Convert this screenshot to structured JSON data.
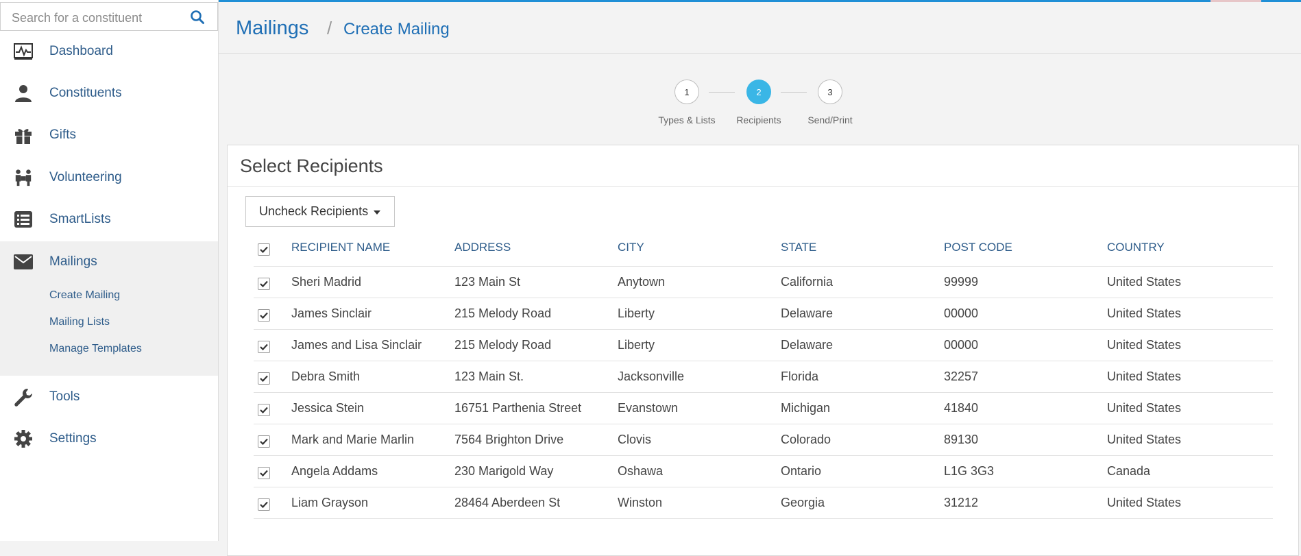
{
  "sidebar": {
    "search_placeholder": "Search for a constituent",
    "items": [
      {
        "label": "Dashboard",
        "icon": "dashboard-icon"
      },
      {
        "label": "Constituents",
        "icon": "person-icon"
      },
      {
        "label": "Gifts",
        "icon": "gift-icon"
      },
      {
        "label": "Volunteering",
        "icon": "volunteers-icon"
      },
      {
        "label": "SmartLists",
        "icon": "list-icon"
      },
      {
        "label": "Mailings",
        "icon": "envelope-icon"
      },
      {
        "label": "Tools",
        "icon": "wrench-icon"
      },
      {
        "label": "Settings",
        "icon": "gear-icon"
      }
    ],
    "mailings_sub": [
      "Create Mailing",
      "Mailing Lists",
      "Manage Templates"
    ]
  },
  "header": {
    "breadcrumb_root": "Mailings",
    "separator": "/",
    "breadcrumb_current": "Create Mailing"
  },
  "steps": [
    {
      "number": "1",
      "label": "Types & Lists"
    },
    {
      "number": "2",
      "label": "Recipients"
    },
    {
      "number": "3",
      "label": "Send/Print"
    }
  ],
  "panel": {
    "title": "Select Recipients",
    "dropdown_label": "Uncheck Recipients",
    "columns": [
      "RECIPIENT NAME",
      "ADDRESS",
      "CITY",
      "STATE",
      "POST CODE",
      "COUNTRY"
    ],
    "rows": [
      {
        "name": "Sheri Madrid",
        "address": "123 Main St",
        "city": "Anytown",
        "state": "California",
        "post": "99999",
        "country": "United States"
      },
      {
        "name": "James Sinclair",
        "address": "215 Melody Road",
        "city": "Liberty",
        "state": "Delaware",
        "post": "00000",
        "country": "United States"
      },
      {
        "name": "James and Lisa Sinclair",
        "address": "215 Melody Road",
        "city": "Liberty",
        "state": "Delaware",
        "post": "00000",
        "country": "United States"
      },
      {
        "name": "Debra Smith",
        "address": "123 Main St.",
        "city": "Jacksonville",
        "state": "Florida",
        "post": "32257",
        "country": "United States"
      },
      {
        "name": "Jessica Stein",
        "address": "16751 Parthenia Street",
        "city": "Evanstown",
        "state": "Michigan",
        "post": "41840",
        "country": "United States"
      },
      {
        "name": "Mark and Marie Marlin",
        "address": "7564 Brighton Drive",
        "city": "Clovis",
        "state": "Colorado",
        "post": "89130",
        "country": "United States"
      },
      {
        "name": "Angela Addams",
        "address": "230 Marigold Way",
        "city": "Oshawa",
        "state": "Ontario",
        "post": "L1G 3G3",
        "country": "Canada"
      },
      {
        "name": "Liam Grayson",
        "address": "28464 Aberdeen St",
        "city": "Winston",
        "state": "Georgia",
        "post": "31212",
        "country": "United States"
      }
    ]
  },
  "colors": {
    "accent": "#1f8fd6",
    "link": "#2e5c8a",
    "step_active": "#3ab6e6"
  }
}
